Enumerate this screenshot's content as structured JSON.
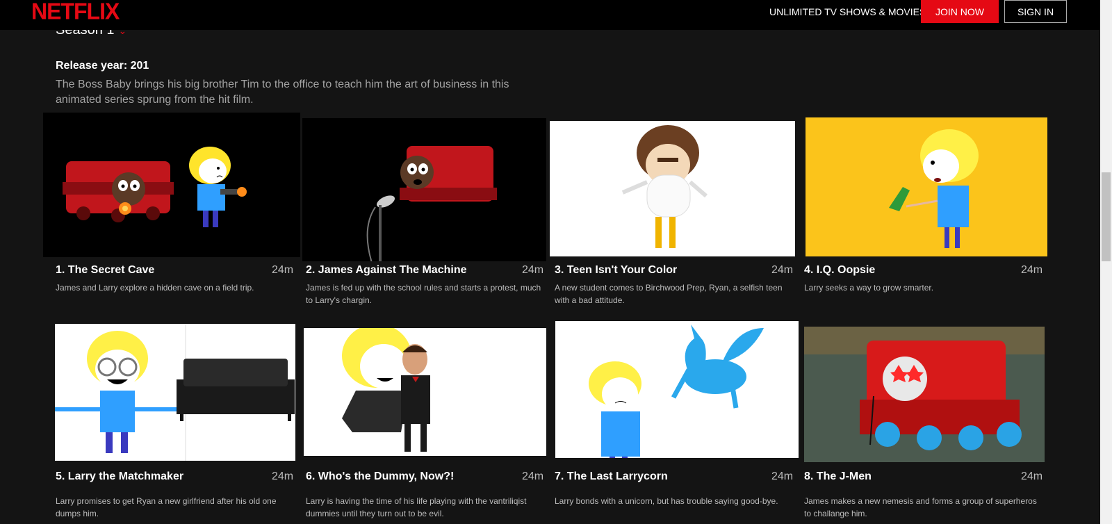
{
  "nav": {
    "logo": "NETFLIX",
    "tagline": "UNLIMITED TV SHOWS & MOVIES",
    "join_label": "JOIN NOW",
    "signin_label": "SIGN IN"
  },
  "season": {
    "label": "Season 1",
    "chevron": "⌄"
  },
  "release": "Release year: 201",
  "synopsis": "The Boss Baby brings his big brother Tim to the office to teach him the art of business in this animated series sprung from the hit film.",
  "episodes": [
    {
      "title": "1. The Secret Cave",
      "duration": "24m",
      "description": "James and Larry explore a hidden cave on a field trip."
    },
    {
      "title": "2. James Against The Machine",
      "duration": "24m",
      "description": "James is fed up with the school rules and starts a protest, much to Larry's chargin."
    },
    {
      "title": "3. Teen Isn't Your Color",
      "duration": "24m",
      "description": "A new student comes to Birchwood Prep, Ryan, a selfish teen with a bad attitude."
    },
    {
      "title": "4. I.Q. Oopsie",
      "duration": "24m",
      "description": "Larry seeks a way to grow smarter."
    },
    {
      "title": "5. Larry the Matchmaker",
      "duration": "24m",
      "description": "Larry promises to get Ryan a new girlfriend after his old one dumps him."
    },
    {
      "title": "6. Who's the Dummy, Now?!",
      "duration": "24m",
      "description": "Larry is having the time of his life playing with the vantriliqist dummies until they turn out to be evil."
    },
    {
      "title": "7. The Last Larrycorn",
      "duration": "24m",
      "description": "Larry bonds with a unicorn, but has trouble saying good-bye."
    },
    {
      "title": "8. The J-Men",
      "duration": "24m",
      "description": "James makes a new nemesis and forms a group of superheros to challange him."
    }
  ],
  "colors": {
    "brand": "#e50914",
    "background": "#141414",
    "nav_background": "#000000",
    "muted_text": "#bcbcbc"
  }
}
